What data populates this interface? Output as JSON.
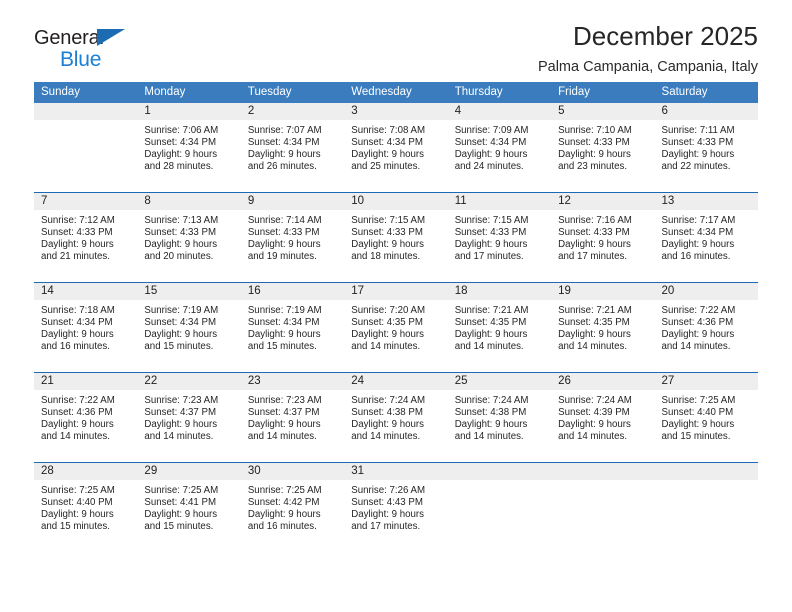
{
  "brand": {
    "name_top": "General",
    "name_bottom": "Blue"
  },
  "header": {
    "title": "December 2025",
    "subtitle": "Palma Campania, Campania, Italy"
  },
  "weekday_headers": [
    "Sunday",
    "Monday",
    "Tuesday",
    "Wednesday",
    "Thursday",
    "Friday",
    "Saturday"
  ],
  "colors": {
    "header_background": "#3a7cbe",
    "row_divider": "#1c6ab4",
    "daynum_background": "#eeeeee",
    "brand_blue": "#1b7fd4",
    "brand_triangle": "#1b6cb3"
  },
  "weeks": [
    [
      {
        "day": "",
        "sunrise": "",
        "sunset": "",
        "daylight_1": "",
        "daylight_2": ""
      },
      {
        "day": "1",
        "sunrise": "Sunrise: 7:06 AM",
        "sunset": "Sunset: 4:34 PM",
        "daylight_1": "Daylight: 9 hours",
        "daylight_2": "and 28 minutes."
      },
      {
        "day": "2",
        "sunrise": "Sunrise: 7:07 AM",
        "sunset": "Sunset: 4:34 PM",
        "daylight_1": "Daylight: 9 hours",
        "daylight_2": "and 26 minutes."
      },
      {
        "day": "3",
        "sunrise": "Sunrise: 7:08 AM",
        "sunset": "Sunset: 4:34 PM",
        "daylight_1": "Daylight: 9 hours",
        "daylight_2": "and 25 minutes."
      },
      {
        "day": "4",
        "sunrise": "Sunrise: 7:09 AM",
        "sunset": "Sunset: 4:34 PM",
        "daylight_1": "Daylight: 9 hours",
        "daylight_2": "and 24 minutes."
      },
      {
        "day": "5",
        "sunrise": "Sunrise: 7:10 AM",
        "sunset": "Sunset: 4:33 PM",
        "daylight_1": "Daylight: 9 hours",
        "daylight_2": "and 23 minutes."
      },
      {
        "day": "6",
        "sunrise": "Sunrise: 7:11 AM",
        "sunset": "Sunset: 4:33 PM",
        "daylight_1": "Daylight: 9 hours",
        "daylight_2": "and 22 minutes."
      }
    ],
    [
      {
        "day": "7",
        "sunrise": "Sunrise: 7:12 AM",
        "sunset": "Sunset: 4:33 PM",
        "daylight_1": "Daylight: 9 hours",
        "daylight_2": "and 21 minutes."
      },
      {
        "day": "8",
        "sunrise": "Sunrise: 7:13 AM",
        "sunset": "Sunset: 4:33 PM",
        "daylight_1": "Daylight: 9 hours",
        "daylight_2": "and 20 minutes."
      },
      {
        "day": "9",
        "sunrise": "Sunrise: 7:14 AM",
        "sunset": "Sunset: 4:33 PM",
        "daylight_1": "Daylight: 9 hours",
        "daylight_2": "and 19 minutes."
      },
      {
        "day": "10",
        "sunrise": "Sunrise: 7:15 AM",
        "sunset": "Sunset: 4:33 PM",
        "daylight_1": "Daylight: 9 hours",
        "daylight_2": "and 18 minutes."
      },
      {
        "day": "11",
        "sunrise": "Sunrise: 7:15 AM",
        "sunset": "Sunset: 4:33 PM",
        "daylight_1": "Daylight: 9 hours",
        "daylight_2": "and 17 minutes."
      },
      {
        "day": "12",
        "sunrise": "Sunrise: 7:16 AM",
        "sunset": "Sunset: 4:33 PM",
        "daylight_1": "Daylight: 9 hours",
        "daylight_2": "and 17 minutes."
      },
      {
        "day": "13",
        "sunrise": "Sunrise: 7:17 AM",
        "sunset": "Sunset: 4:34 PM",
        "daylight_1": "Daylight: 9 hours",
        "daylight_2": "and 16 minutes."
      }
    ],
    [
      {
        "day": "14",
        "sunrise": "Sunrise: 7:18 AM",
        "sunset": "Sunset: 4:34 PM",
        "daylight_1": "Daylight: 9 hours",
        "daylight_2": "and 16 minutes."
      },
      {
        "day": "15",
        "sunrise": "Sunrise: 7:19 AM",
        "sunset": "Sunset: 4:34 PM",
        "daylight_1": "Daylight: 9 hours",
        "daylight_2": "and 15 minutes."
      },
      {
        "day": "16",
        "sunrise": "Sunrise: 7:19 AM",
        "sunset": "Sunset: 4:34 PM",
        "daylight_1": "Daylight: 9 hours",
        "daylight_2": "and 15 minutes."
      },
      {
        "day": "17",
        "sunrise": "Sunrise: 7:20 AM",
        "sunset": "Sunset: 4:35 PM",
        "daylight_1": "Daylight: 9 hours",
        "daylight_2": "and 14 minutes."
      },
      {
        "day": "18",
        "sunrise": "Sunrise: 7:21 AM",
        "sunset": "Sunset: 4:35 PM",
        "daylight_1": "Daylight: 9 hours",
        "daylight_2": "and 14 minutes."
      },
      {
        "day": "19",
        "sunrise": "Sunrise: 7:21 AM",
        "sunset": "Sunset: 4:35 PM",
        "daylight_1": "Daylight: 9 hours",
        "daylight_2": "and 14 minutes."
      },
      {
        "day": "20",
        "sunrise": "Sunrise: 7:22 AM",
        "sunset": "Sunset: 4:36 PM",
        "daylight_1": "Daylight: 9 hours",
        "daylight_2": "and 14 minutes."
      }
    ],
    [
      {
        "day": "21",
        "sunrise": "Sunrise: 7:22 AM",
        "sunset": "Sunset: 4:36 PM",
        "daylight_1": "Daylight: 9 hours",
        "daylight_2": "and 14 minutes."
      },
      {
        "day": "22",
        "sunrise": "Sunrise: 7:23 AM",
        "sunset": "Sunset: 4:37 PM",
        "daylight_1": "Daylight: 9 hours",
        "daylight_2": "and 14 minutes."
      },
      {
        "day": "23",
        "sunrise": "Sunrise: 7:23 AM",
        "sunset": "Sunset: 4:37 PM",
        "daylight_1": "Daylight: 9 hours",
        "daylight_2": "and 14 minutes."
      },
      {
        "day": "24",
        "sunrise": "Sunrise: 7:24 AM",
        "sunset": "Sunset: 4:38 PM",
        "daylight_1": "Daylight: 9 hours",
        "daylight_2": "and 14 minutes."
      },
      {
        "day": "25",
        "sunrise": "Sunrise: 7:24 AM",
        "sunset": "Sunset: 4:38 PM",
        "daylight_1": "Daylight: 9 hours",
        "daylight_2": "and 14 minutes."
      },
      {
        "day": "26",
        "sunrise": "Sunrise: 7:24 AM",
        "sunset": "Sunset: 4:39 PM",
        "daylight_1": "Daylight: 9 hours",
        "daylight_2": "and 14 minutes."
      },
      {
        "day": "27",
        "sunrise": "Sunrise: 7:25 AM",
        "sunset": "Sunset: 4:40 PM",
        "daylight_1": "Daylight: 9 hours",
        "daylight_2": "and 15 minutes."
      }
    ],
    [
      {
        "day": "28",
        "sunrise": "Sunrise: 7:25 AM",
        "sunset": "Sunset: 4:40 PM",
        "daylight_1": "Daylight: 9 hours",
        "daylight_2": "and 15 minutes."
      },
      {
        "day": "29",
        "sunrise": "Sunrise: 7:25 AM",
        "sunset": "Sunset: 4:41 PM",
        "daylight_1": "Daylight: 9 hours",
        "daylight_2": "and 15 minutes."
      },
      {
        "day": "30",
        "sunrise": "Sunrise: 7:25 AM",
        "sunset": "Sunset: 4:42 PM",
        "daylight_1": "Daylight: 9 hours",
        "daylight_2": "and 16 minutes."
      },
      {
        "day": "31",
        "sunrise": "Sunrise: 7:26 AM",
        "sunset": "Sunset: 4:43 PM",
        "daylight_1": "Daylight: 9 hours",
        "daylight_2": "and 17 minutes."
      },
      {
        "day": "",
        "sunrise": "",
        "sunset": "",
        "daylight_1": "",
        "daylight_2": ""
      },
      {
        "day": "",
        "sunrise": "",
        "sunset": "",
        "daylight_1": "",
        "daylight_2": ""
      },
      {
        "day": "",
        "sunrise": "",
        "sunset": "",
        "daylight_1": "",
        "daylight_2": ""
      }
    ]
  ]
}
